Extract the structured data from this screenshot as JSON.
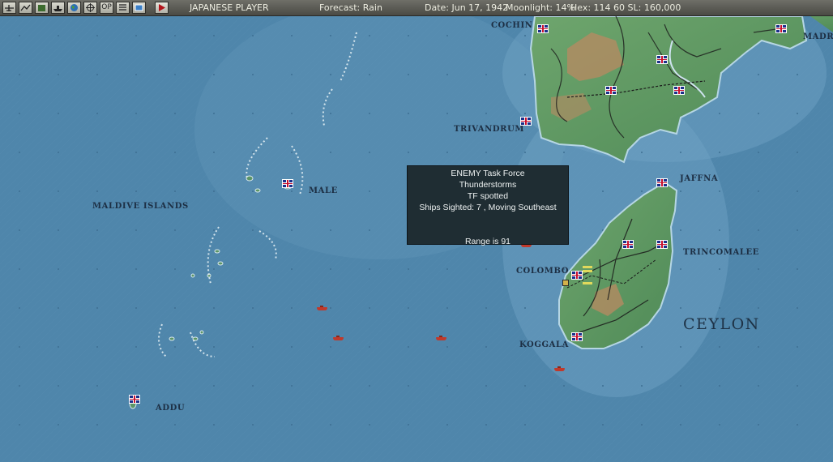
{
  "toolbar": {
    "icons": [
      "air-icon",
      "ground-icon",
      "base-icon",
      "ship-icon",
      "globe-icon",
      "target-icon",
      "op-icon",
      "list-icon",
      "window-icon",
      "end-turn-icon"
    ],
    "op_label": "OP",
    "player": "JAPANESE PLAYER",
    "forecast": "Forecast: Rain",
    "date": "Date: Jun 17, 1942",
    "moonlight": "Moonlight: 14%",
    "hex": "Hex: 114 60  SL: 160,000"
  },
  "map": {
    "labels": {
      "cochin": "COCHIN",
      "madras": "MADRAS",
      "trivandrum": "TRIVANDRUM",
      "jaffna": "JAFFNA",
      "male": "MALE",
      "maldive_islands": "MALDIVE ISLANDS",
      "colombo": "COLOMBO",
      "trincomalee": "TRINCOMALEE",
      "ceylon": "CEYLON",
      "koggala": "KOGGALA",
      "addu": "ADDU"
    }
  },
  "tooltip": {
    "line1": "ENEMY Task Force",
    "line2": "Thunderstorms",
    "line3": "TF spotted",
    "line4": "Ships Sighted: 7 , Moving Southeast",
    "line5": "Range is 91"
  },
  "colors": {
    "sea": "#4f86ab",
    "land": "#5f9a64",
    "tooltip_bg": "#1f2d33",
    "enemy_ship": "#c0392b"
  }
}
